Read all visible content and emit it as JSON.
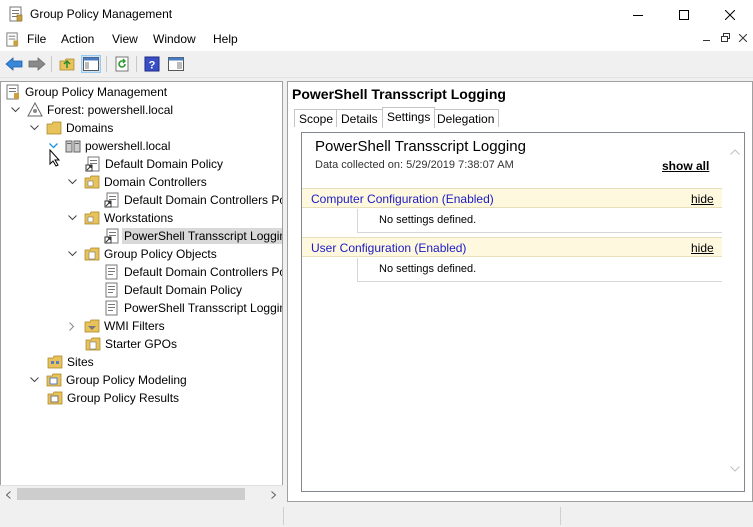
{
  "window": {
    "title": "Group Policy Management",
    "accent": "#0a5ad5"
  },
  "menu": {
    "file": "File",
    "action": "Action",
    "view": "View",
    "window": "Window",
    "help": "Help"
  },
  "toolbar": {
    "icons": [
      "back-arrow-icon",
      "forward-arrow-icon",
      "up-folder-icon",
      "show-hide-tree-icon",
      "refresh-icon",
      "help-icon",
      "properties-icon"
    ]
  },
  "tree": {
    "root": "Group Policy Management",
    "forest": "Forest: powershell.local",
    "domains": "Domains",
    "domain": "powershell.local",
    "default_domain_policy": "Default Domain Policy",
    "domain_controllers": "Domain Controllers",
    "ddc_policy": "Default Domain Controllers Po",
    "workstations": "Workstations",
    "ps_transcript": "PowerShell Transscript Loggin",
    "gpo_container": "Group Policy Objects",
    "gpo_ddc": "Default Domain Controllers Po",
    "gpo_ddp": "Default Domain Policy",
    "gpo_ps": "PowerShell Transscript Loggin",
    "wmi_filters": "WMI Filters",
    "starter_gpos": "Starter GPOs",
    "sites": "Sites",
    "modeling": "Group Policy Modeling",
    "results": "Group Policy Results"
  },
  "right": {
    "title": "PowerShell Transscript Logging",
    "tabs": {
      "scope": "Scope",
      "details": "Details",
      "settings": "Settings",
      "delegation": "Delegation"
    },
    "report": {
      "title": "PowerShell Transscript Logging",
      "collected": "Data collected on: 5/29/2019 7:38:07 AM",
      "show_all": "show all",
      "computer_section": "Computer Configuration (Enabled)",
      "user_section": "User Configuration (Enabled)",
      "hide": "hide",
      "no_settings": "No settings defined."
    }
  }
}
